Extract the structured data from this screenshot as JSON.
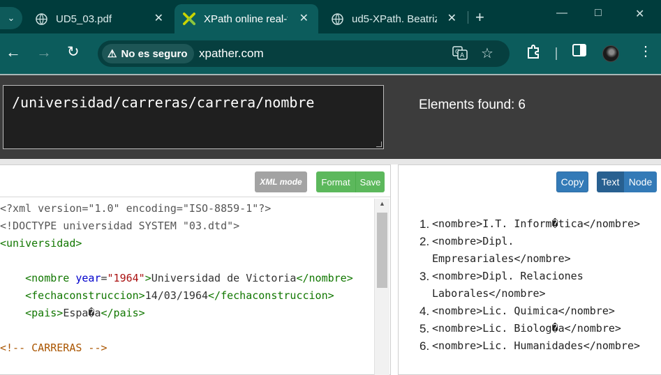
{
  "browser": {
    "tabs": [
      {
        "title": "UD5_03.pdf",
        "icon": "globe-icon",
        "active": false
      },
      {
        "title": "XPath online real-t",
        "icon": "xpather-logo-icon",
        "active": true
      },
      {
        "title": "ud5-XPath. Beatriz",
        "icon": "globe-icon",
        "active": false
      }
    ],
    "security_label": "No es seguro",
    "url": "xpather.com"
  },
  "xpath": {
    "expression": "/universidad/carreras/carrera/nombre",
    "found_label": "Elements found:",
    "found_count": "6"
  },
  "editor": {
    "xml_mode_label": "XML mode",
    "format_label": "Format",
    "save_label": "Save",
    "lines": [
      [
        {
          "t": "<?xml version=\"1.0\" encoding=\"ISO-8859-1\"?>",
          "c": "pi"
        }
      ],
      [
        {
          "t": "<!DOCTYPE universidad SYSTEM \"03.dtd\">",
          "c": "pi"
        }
      ],
      [
        {
          "t": "<universidad>",
          "c": "tag"
        }
      ],
      [],
      [
        {
          "t": "    ",
          "c": ""
        },
        {
          "t": "<nombre ",
          "c": "tag"
        },
        {
          "t": "year",
          "c": "attr"
        },
        {
          "t": "=",
          "c": ""
        },
        {
          "t": "\"1964\"",
          "c": "val"
        },
        {
          "t": ">",
          "c": "tag"
        },
        {
          "t": "Universidad de Victoria",
          "c": ""
        },
        {
          "t": "</nombre>",
          "c": "tag"
        }
      ],
      [
        {
          "t": "    ",
          "c": ""
        },
        {
          "t": "<fechaconstruccion>",
          "c": "tag"
        },
        {
          "t": "14/03/1964",
          "c": ""
        },
        {
          "t": "</fechaconstruccion>",
          "c": "tag"
        }
      ],
      [
        {
          "t": "    ",
          "c": ""
        },
        {
          "t": "<pais>",
          "c": "tag"
        },
        {
          "t": "Espa�a",
          "c": ""
        },
        {
          "t": "</pais>",
          "c": "tag"
        }
      ],
      [],
      [
        {
          "t": "<!-- CARRERAS -->",
          "c": "com"
        }
      ]
    ]
  },
  "results": {
    "copy_label": "Copy",
    "text_label": "Text",
    "node_label": "Node",
    "items": [
      {
        "num": "1.",
        "text": "<nombre>I.T. Inform�tica</nombre>"
      },
      {
        "num": "2.",
        "text": "<nombre>Dipl. Empresariales</nombre>"
      },
      {
        "num": "3.",
        "text": "<nombre>Dipl. Relaciones Laborales</nombre>"
      },
      {
        "num": "4.",
        "text": "<nombre>Lic. Quimica</nombre>"
      },
      {
        "num": "5.",
        "text": "<nombre>Lic. Biolog�a</nombre>"
      },
      {
        "num": "6.",
        "text": "<nombre>Lic. Humanidades</nombre>"
      }
    ]
  },
  "colors": {
    "chrome_dark": "#003c3c",
    "chrome_toolbar": "#0c5c5c",
    "xpath_bar": "#3c3c3c",
    "success_green": "#5cb85c",
    "primary_blue": "#337ab7",
    "xml_tag": "#117700",
    "xml_attr": "#0000cc",
    "xml_value": "#aa1111",
    "xml_comment": "#aa5500"
  }
}
